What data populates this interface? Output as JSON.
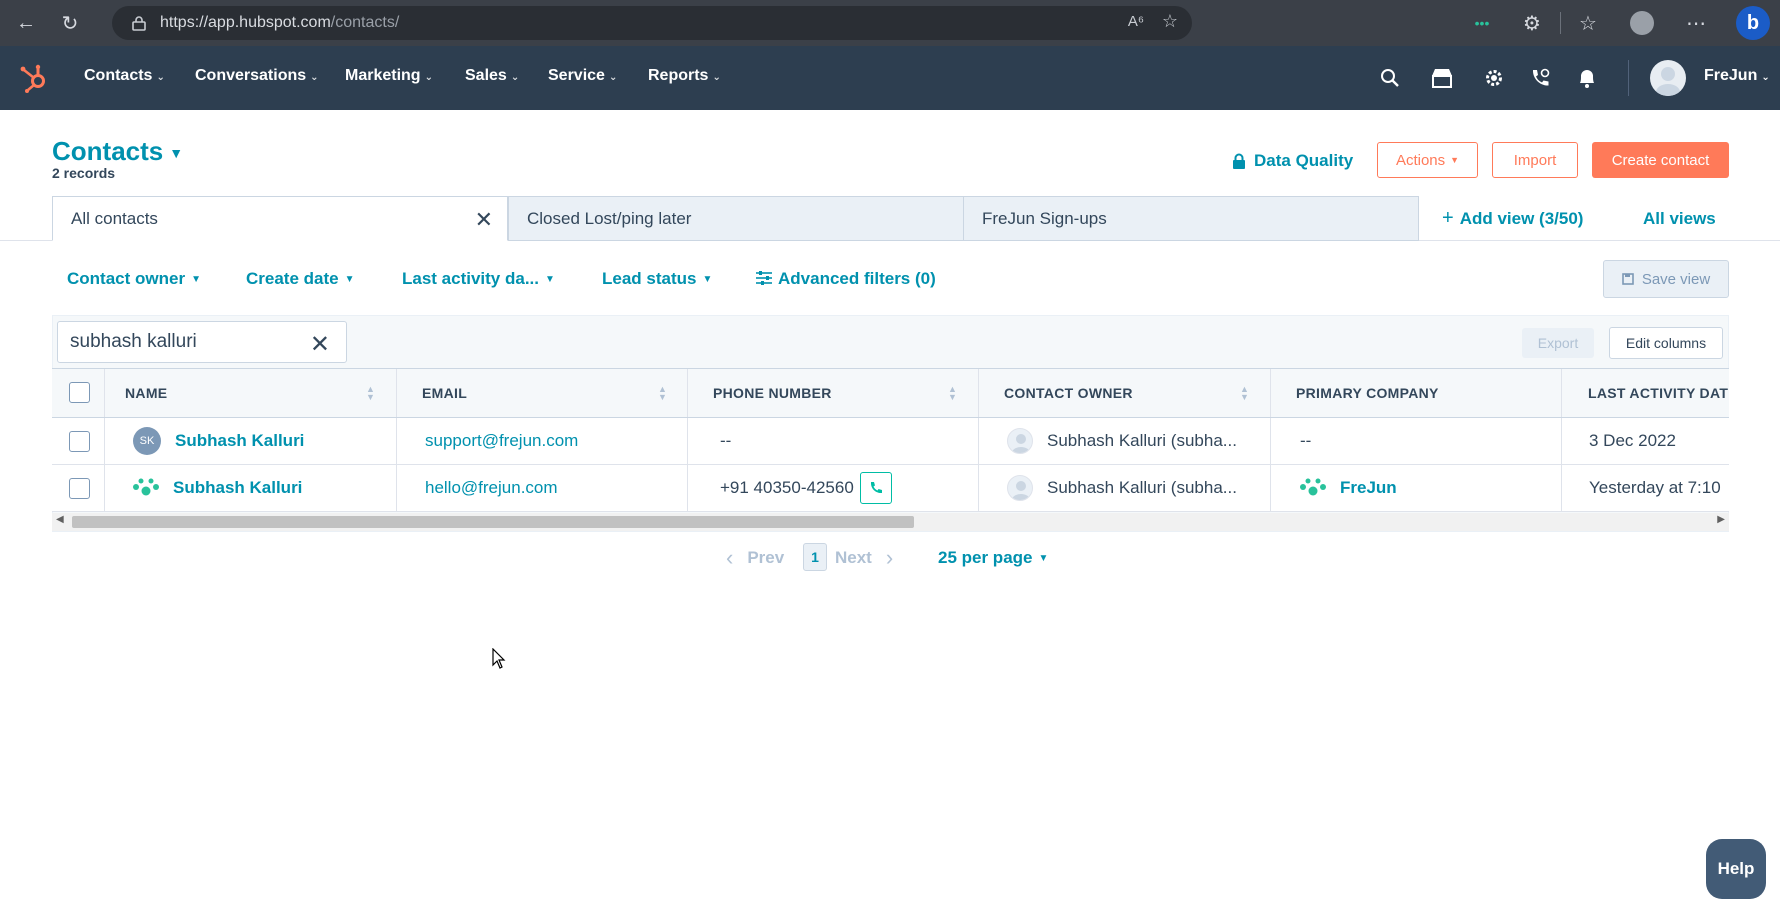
{
  "browser": {
    "url_host": "https://app.hubspot.com",
    "url_path": "/contacts/"
  },
  "nav": {
    "items": [
      {
        "label": "Contacts"
      },
      {
        "label": "Conversations"
      },
      {
        "label": "Marketing"
      },
      {
        "label": "Sales"
      },
      {
        "label": "Service"
      },
      {
        "label": "Reports"
      }
    ],
    "user": "FreJun"
  },
  "header": {
    "title": "Contacts",
    "records": "2 records",
    "data_quality": "Data Quality",
    "actions": "Actions",
    "import": "Import",
    "create": "Create contact"
  },
  "tabs": [
    {
      "label": "All contacts"
    },
    {
      "label": "Closed Lost/ping later"
    },
    {
      "label": "FreJun Sign-ups"
    }
  ],
  "add_view": "Add view (3/50)",
  "all_views": "All views",
  "filters": [
    {
      "label": "Contact owner"
    },
    {
      "label": "Create date"
    },
    {
      "label": "Last activity da..."
    },
    {
      "label": "Lead status"
    },
    {
      "label": "Advanced filters (0)"
    }
  ],
  "save_view": "Save view",
  "search": {
    "value": "subhash kalluri"
  },
  "export": "Export",
  "edit_columns": "Edit columns",
  "columns": [
    "NAME",
    "EMAIL",
    "PHONE NUMBER",
    "CONTACT OWNER",
    "PRIMARY COMPANY",
    "LAST ACTIVITY DAT"
  ],
  "rows": [
    {
      "initials": "SK",
      "name": "Subhash Kalluri",
      "email": "support@frejun.com",
      "phone": "--",
      "owner": "Subhash Kalluri (subha...",
      "company": "--",
      "last_activity": "3 Dec 2022"
    },
    {
      "name": "Subhash Kalluri",
      "email": "hello@frejun.com",
      "phone": "+91 40350-42560",
      "owner": "Subhash Kalluri (subha...",
      "company": "FreJun",
      "last_activity": "Yesterday at 7:10"
    }
  ],
  "pager": {
    "prev": "Prev",
    "current": "1",
    "next": "Next",
    "per_page": "25 per page"
  },
  "help": "Help",
  "colors": {
    "accent": "#0091ae",
    "orange": "#ff7a59",
    "nav_bg": "#2d3e50",
    "frejun_green": "#00bda5"
  }
}
